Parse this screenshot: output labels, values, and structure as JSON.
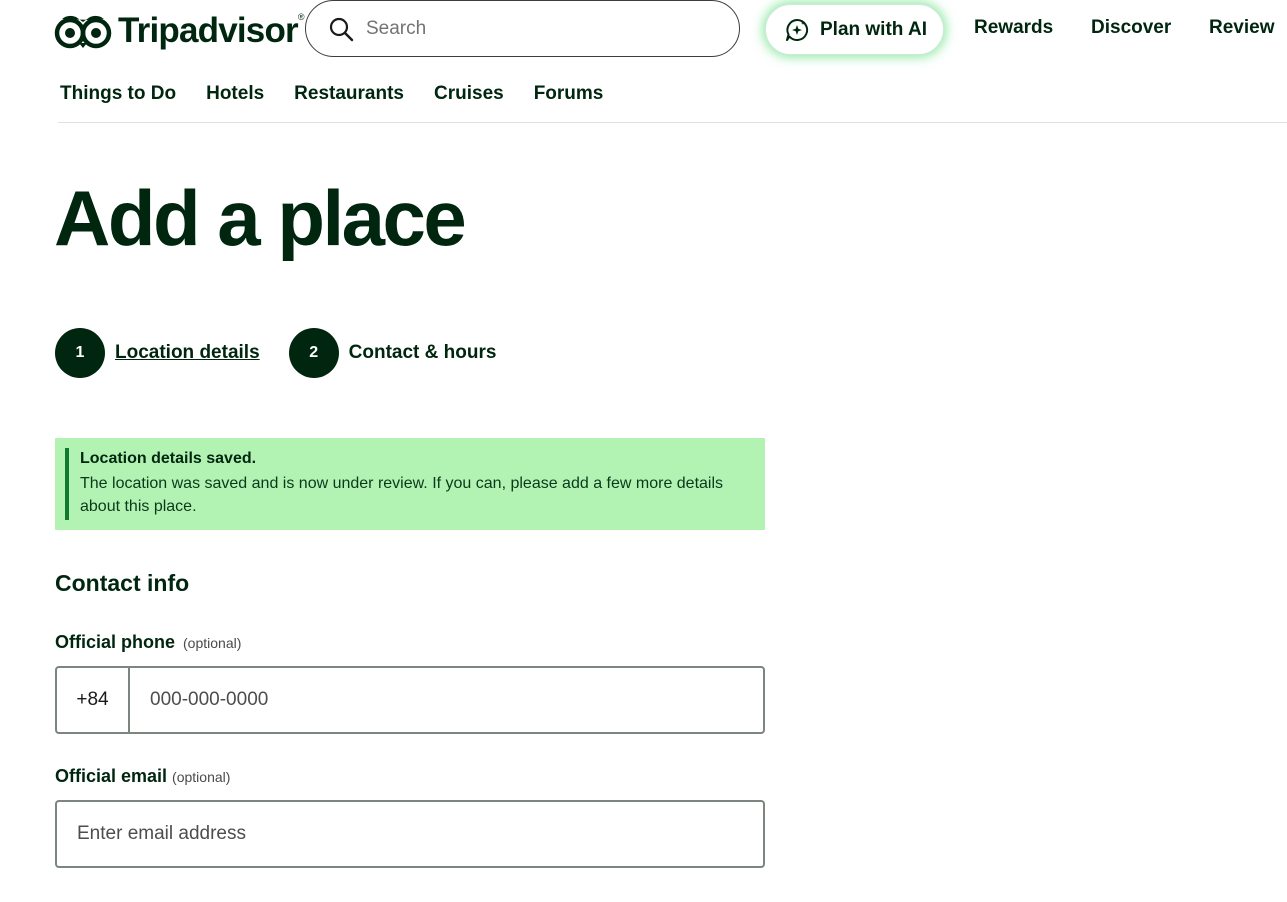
{
  "header": {
    "logo_text": "Tripadvisor",
    "search": {
      "placeholder": "Search"
    },
    "ai_button_label": "Plan with AI",
    "nav": [
      "Rewards",
      "Discover",
      "Review"
    ]
  },
  "sub_nav": [
    "Things to Do",
    "Hotels",
    "Restaurants",
    "Cruises",
    "Forums"
  ],
  "page_title": "Add a place",
  "steps": [
    {
      "number": "1",
      "label": "Location details"
    },
    {
      "number": "2",
      "label": "Contact & hours"
    }
  ],
  "banner": {
    "title": "Location details saved.",
    "text": "The location was saved and is now under review. If you can, please add a few more details about this place."
  },
  "contact": {
    "section_title": "Contact info",
    "phone": {
      "label": "Official phone",
      "optional": "(optional)",
      "prefix": "+84",
      "placeholder": "000-000-0000"
    },
    "email": {
      "label": "Official email",
      "optional": "(optional)",
      "placeholder": "Enter email address"
    }
  },
  "colors": {
    "brand_dark": "#00260f",
    "banner_bg": "#b2f2b3",
    "banner_accent": "#0f7a2f",
    "ai_glow": "#48dc6e"
  }
}
